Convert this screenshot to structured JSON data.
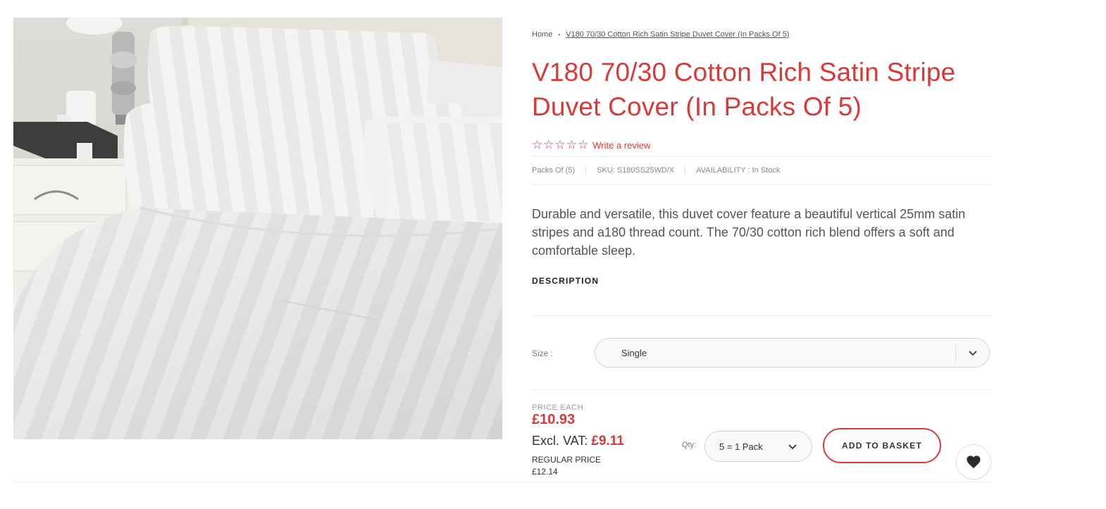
{
  "breadcrumb": {
    "home": "Home",
    "separator": "•",
    "current": "V180 70/30 Cotton Rich Satin Stripe Duvet Cover (In Packs Of 5)"
  },
  "product": {
    "title": "V180 70/30 Cotton Rich Satin Stripe Duvet Cover (In Packs Of 5)",
    "rating": {
      "stars_filled": 0,
      "stars_total": 5,
      "write_review": "Write a review"
    },
    "meta": {
      "pack": "Packs Of (5)",
      "sku": "SKU: S180SS25WD/X",
      "availability": "AVAILABILITY : In Stock"
    },
    "summary": "Durable and versatile, this duvet cover feature a beautiful vertical 25mm satin stripes and a180 thread count. The 70/30 cotton rich blend offers a soft and comfortable sleep.",
    "description_heading": "DESCRIPTION"
  },
  "options": {
    "size_label": "Size :",
    "size_value": "Single"
  },
  "pricing": {
    "price_each_label": "PRICE EACH",
    "price_each": "£10.93",
    "excl_vat_label": "Excl. VAT:",
    "excl_vat_value": "£9.11",
    "regular_label": "REGULAR PRICE",
    "regular_value": "£12.14"
  },
  "purchase": {
    "qty_label": "Qty:",
    "qty_value": "5 = 1 Pack",
    "add_to_basket": "ADD TO BASKET"
  },
  "icons": {
    "star": "star-outline-icon",
    "chevron": "chevron-down-icon",
    "wishlist": "heart-icon"
  },
  "colors": {
    "accent": "#d83a3a",
    "text": "#333333",
    "muted": "#888888"
  }
}
